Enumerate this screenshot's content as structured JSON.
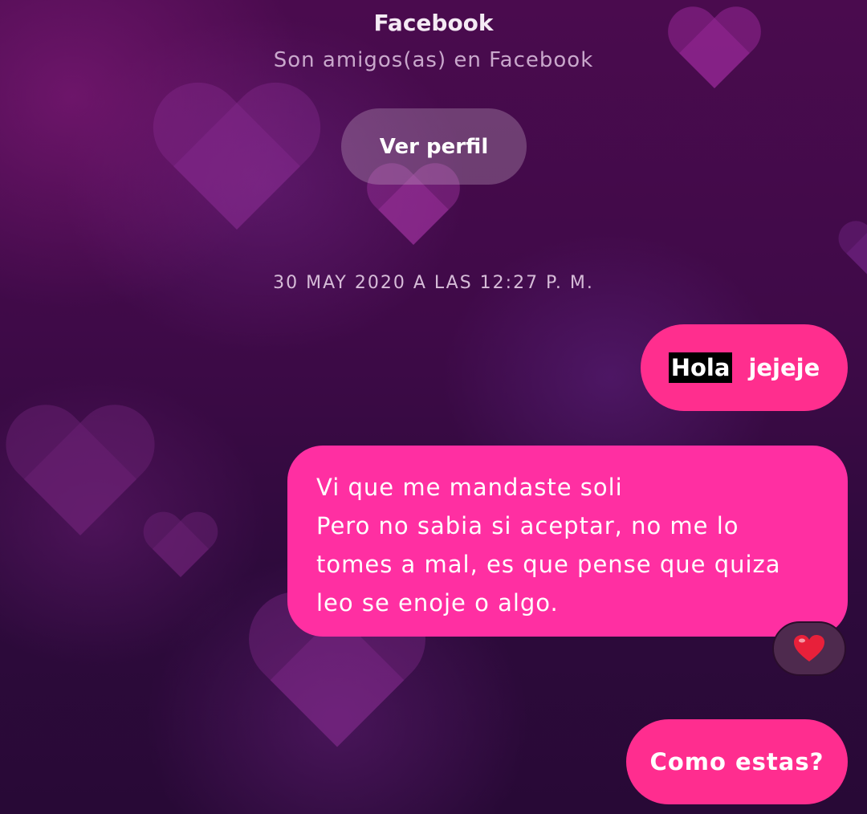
{
  "header": {
    "title": "Facebook",
    "subtitle": "Son amigos(as) en Facebook",
    "profile_button_label": "Ver perfil"
  },
  "conversation": {
    "timestamp": "30 MAY 2020 A LAS 12:27 P. M.",
    "messages": [
      {
        "parts": [
          "Hola",
          "jejeje"
        ]
      },
      {
        "lines": [
          "Vi que me mandaste soli",
          "Pero no sabia si aceptar, no me lo",
          "tomes a mal, es que pense que quiza",
          "leo se enoje o algo."
        ],
        "reaction_icon": "heart-reaction-icon"
      },
      {
        "text": "Como estas?"
      }
    ]
  },
  "colors": {
    "outgoing_bubble": "#ff2e8e",
    "outgoing_bubble_alt": "#ff2fa2",
    "background_top": "#4a0b4e",
    "background_bottom": "#280936",
    "reaction_heart": "#e8203a"
  }
}
